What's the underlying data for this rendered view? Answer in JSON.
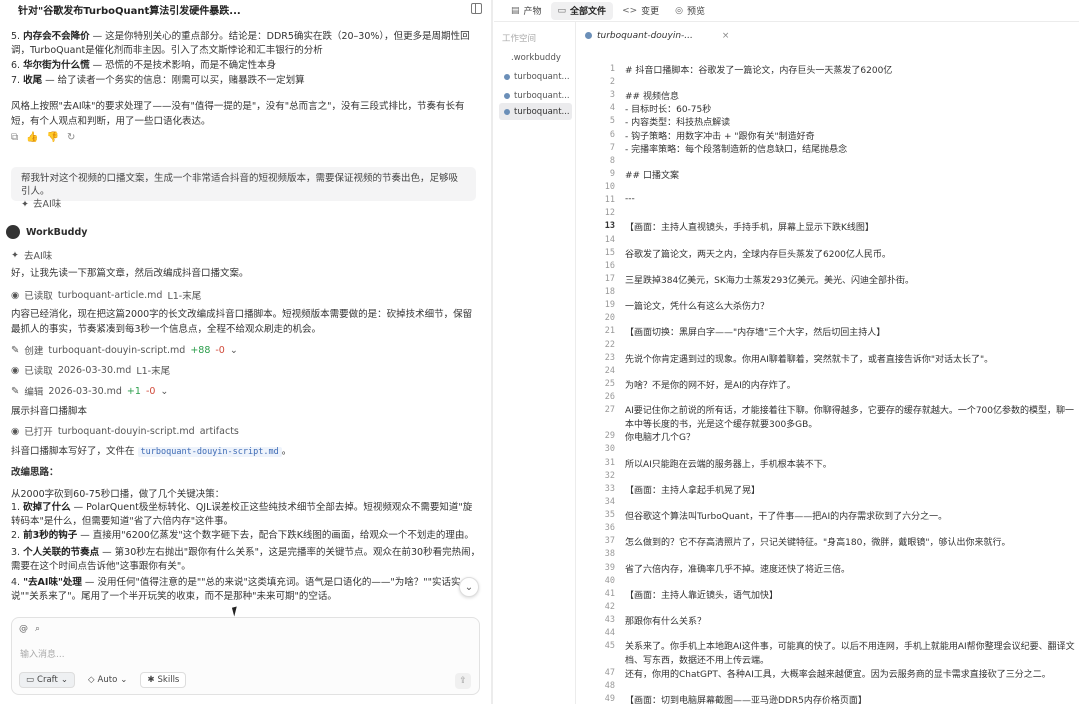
{
  "chat": {
    "title": "针对\"谷歌发布TurboQuant算法引发硬件暴跌...",
    "list_items": [
      {
        "num": "5.",
        "bold": "内存会不会降价",
        "text": " — 这是你特别关心的重点部分。结论是：DDR5确实在跌（20–30%），但更多是周期性回调，TurboQuant是催化剂而非主因。引入了杰文斯悖论和汇丰银行的分析"
      },
      {
        "num": "6.",
        "bold": "华尔街为什么慌",
        "text": " — 恐慌的不是技术影响，而是不确定性本身"
      },
      {
        "num": "7.",
        "bold": "收尾",
        "text": " — 给了读者一个务实的信息：刚需可以买，赌暴跌不一定划算"
      }
    ],
    "style_note": "风格上按照\"去AI味\"的要求处理了——没有\"值得一提的是\"，没有\"总而言之\"，没有三段式排比，节奏有长有短，有个人观点和判断，用了一些口语化表达。",
    "reactions": [
      "⧉",
      "👍",
      "👎",
      "↻"
    ],
    "quote_text": "帮我针对这个视频的口播文案，生成一个非常适合抖音的短视频版本，需要保证视频的节奏出色，足够吸引人。",
    "quote_tag": "去AI味",
    "assistant_name": "WorkBuddy",
    "skill_tag": "去AI味",
    "intro": "好，让我先读一下那篇文章，然后改编成抖音口播文案。",
    "read1_label": "已读取",
    "read1_file": "turboquant-article.md",
    "read1_range": "L1-末尾",
    "plan_text": "内容已经消化，现在把这篇2000字的长文改编成抖音口播脚本。短视频版本需要做的是：砍掉技术细节，保留最抓人的事实，节奏紧凑到每3秒一个信息点，全程不给观众刷走的机会。",
    "create_label": "创建",
    "create_file": "turboquant-douyin-script.md",
    "create_add": "+88",
    "create_del": "-0",
    "read2_label": "已读取",
    "read2_file": "2026-03-30.md",
    "read2_range": "L1-末尾",
    "edit_label": "编辑",
    "edit_file": "2026-03-30.md",
    "edit_add": "+1",
    "edit_del": "-0",
    "show_script": "展示抖音口播脚本",
    "open_label": "已打开",
    "open_file": "turboquant-douyin-script.md",
    "open_kind": "artifacts",
    "done_pre": "抖音口播脚本写好了，文件在",
    "done_file": "turboquant-douyin-script.md",
    "done_post": "。",
    "idea_title": "改编思路：",
    "idea_lead": "从2000字砍到60-75秒口播，做了几个关键决策：",
    "ideas": [
      {
        "num": "1.",
        "bold": "砍掉了什么",
        "text": " — PolarQuent极坐标转化、QJL误差校正这些纯技术细节全部去掉。短视频观众不需要知道\"旋转码本\"是什么，但需要知道\"省了六倍内存\"这件事。"
      },
      {
        "num": "2.",
        "bold": "前3秒的钩子",
        "text": " — 直接用\"6200亿蒸发\"这个数字砸下去，配合下跌K线图的画面，给观众一个不划走的理由。"
      },
      {
        "num": "3.",
        "bold": "个人关联的节奏点",
        "text": " — 第30秒左右抛出\"跟你有什么关系\"，这是完播率的关键节点。观众在前30秒看完热闹，需要在这个时间点告诉他\"这事跟你有关\"。"
      },
      {
        "num": "4.",
        "bold": "\"去AI味\"处理",
        "text": " — 没用任何\"值得注意的是\"\"总的来说\"这类填充词。语气是口语化的——\"为啥？\"\"实话实说\"\"关系来了\"。尾用了一个半开玩笑的收束，而不是那种\"未来可期\"的空话。"
      }
    ],
    "composer_placeholder": "输入消息...",
    "mode_label": "Craft",
    "auto_label": "Auto",
    "skills_label": "Skills"
  },
  "topbar": {
    "tabs": [
      {
        "icon": "▤",
        "label": "产物"
      },
      {
        "icon": "▭",
        "label": "全部文件"
      },
      {
        "icon": "<>",
        "label": "变更"
      },
      {
        "icon": "◎",
        "label": "预览"
      }
    ]
  },
  "explorer": {
    "label": "工作空间",
    "files": [
      ".workbuddy",
      "turboquant...",
      "turboquant...",
      "turboquant..."
    ]
  },
  "editor": {
    "tab_name": "turboquant-douyin-...",
    "lines": [
      {
        "n": "1",
        "t": "# 抖音口播脚本：谷歌发了一篇论文，内存巨头一天蒸发了6200亿"
      },
      {
        "n": "2",
        "t": ""
      },
      {
        "n": "3",
        "t": "## 视频信息"
      },
      {
        "n": "4",
        "t": "- 目标时长：60-75秒"
      },
      {
        "n": "5",
        "t": "- 内容类型：科技热点解读"
      },
      {
        "n": "6",
        "t": "- 钩子策略：用数字冲击 + \"跟你有关\"制造好奇"
      },
      {
        "n": "7",
        "t": "- 完播率策略：每个段落制造新的信息缺口，结尾抛悬念"
      },
      {
        "n": "8",
        "t": ""
      },
      {
        "n": "9",
        "t": "## 口播文案"
      },
      {
        "n": "10",
        "t": ""
      },
      {
        "n": "11",
        "t": "---"
      },
      {
        "n": "12",
        "t": ""
      },
      {
        "n": "13",
        "t": "【画面：主持人直视镜头，手持手机，屏幕上显示下跌K线图】"
      },
      {
        "n": "14",
        "t": ""
      },
      {
        "n": "15",
        "t": "谷歌发了篇论文，两天之内，全球内存巨头蒸发了6200亿人民币。"
      },
      {
        "n": "16",
        "t": ""
      },
      {
        "n": "17",
        "t": "三星跌掉384亿美元，SK海力士蒸发293亿美元。美光、闪迪全部扑街。"
      },
      {
        "n": "18",
        "t": ""
      },
      {
        "n": "19",
        "t": "一篇论文，凭什么有这么大杀伤力？"
      },
      {
        "n": "20",
        "t": ""
      },
      {
        "n": "21",
        "t": "【画面切换：黑屏白字——\"内存墙\"三个大字，然后切回主持人】"
      },
      {
        "n": "22",
        "t": ""
      },
      {
        "n": "23",
        "t": "先说个你肯定遇到过的现象。你用AI聊着聊着，突然就卡了，或者直接告诉你\"对话太长了\"。"
      },
      {
        "n": "24",
        "t": ""
      },
      {
        "n": "25",
        "t": "为啥？不是你的网不好，是AI的内存炸了。"
      },
      {
        "n": "26",
        "t": ""
      },
      {
        "n": "27",
        "t": "AI要记住你之前说的所有话，才能接着往下聊。你聊得越多，它要存的缓存就越大。一个700亿参数的模型，聊一本中等长度的书，光是这个缓存就要300多GB。"
      },
      {
        "n": "29",
        "t": "你电脑才几个G？"
      },
      {
        "n": "30",
        "t": ""
      },
      {
        "n": "31",
        "t": "所以AI只能跑在云端的服务器上，手机根本装不下。"
      },
      {
        "n": "32",
        "t": ""
      },
      {
        "n": "33",
        "t": "【画面：主持人拿起手机晃了晃】"
      },
      {
        "n": "34",
        "t": ""
      },
      {
        "n": "35",
        "t": "但谷歌这个算法叫TurboQuant，干了件事——把AI的内存需求砍到了六分之一。"
      },
      {
        "n": "36",
        "t": ""
      },
      {
        "n": "37",
        "t": "怎么做到的？它不存高清照片了，只记关键特征。\"身高180，微胖，戴眼镜\"，够认出你来就行。"
      },
      {
        "n": "38",
        "t": ""
      },
      {
        "n": "39",
        "t": "省了六倍内存，准确率几乎不掉。速度还快了将近三倍。"
      },
      {
        "n": "40",
        "t": ""
      },
      {
        "n": "41",
        "t": "【画面：主持人靠近镜头，语气加快】"
      },
      {
        "n": "42",
        "t": ""
      },
      {
        "n": "43",
        "t": "那跟你有什么关系？"
      },
      {
        "n": "44",
        "t": ""
      },
      {
        "n": "45",
        "t": "关系来了。你手机上本地跑AI这件事，可能真的快了。以后不用连网，手机上就能用AI帮你整理会议纪要、翻译文档、写东西，数据还不用上传云端。"
      },
      {
        "n": "47",
        "t": "还有，你用的ChatGPT、各种AI工具，大概率会越来越便宜。因为云服务商的显卡需求直接砍了三分之二。"
      },
      {
        "n": "48",
        "t": ""
      },
      {
        "n": "49",
        "t": "【画面：切到电脑屏幕截图——亚马逊DDR5内存价格页面】"
      }
    ]
  }
}
